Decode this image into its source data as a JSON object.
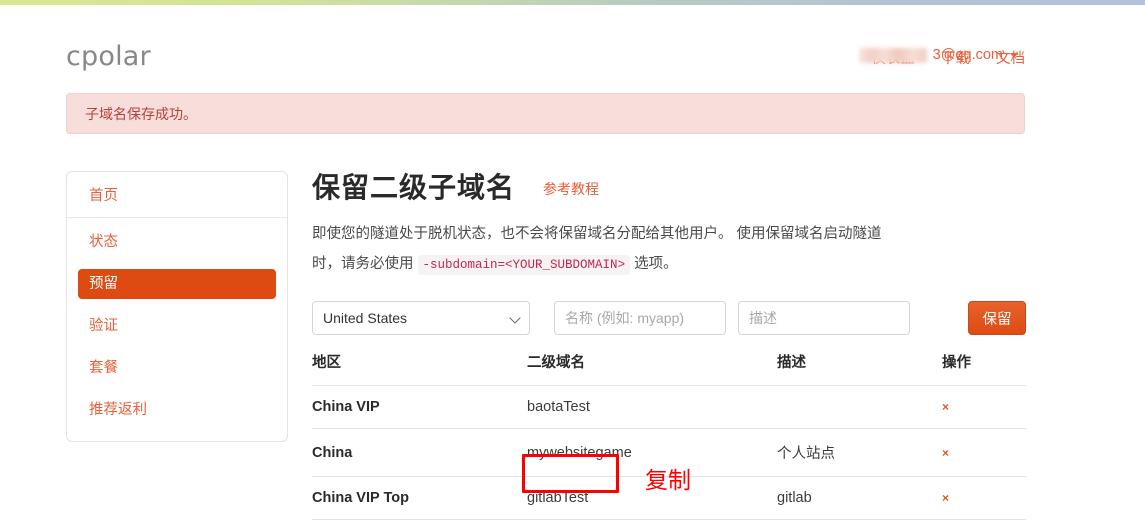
{
  "brand": "cpolar",
  "topbar": {
    "nav_links": [
      {
        "label": "仪表盘"
      },
      {
        "label": "下载"
      },
      {
        "label": "文档"
      }
    ],
    "account": {
      "email_suffix": "3@qq.com",
      "caret_icon": "chevron-down-icon"
    }
  },
  "alert": {
    "message": "子域名保存成功。",
    "bg_color": "#f8dedb",
    "text_color": "#b7403c"
  },
  "sidebar": {
    "header_label": "首页",
    "items": [
      {
        "label": "状态",
        "active": false
      },
      {
        "label": "预留",
        "active": true
      },
      {
        "label": "验证",
        "active": false
      },
      {
        "label": "套餐",
        "active": false
      },
      {
        "label": "推荐返利",
        "active": false
      }
    ],
    "active_bg": "#dd4b12",
    "link_color": "#e8603c"
  },
  "main": {
    "title": "保留二级子域名",
    "tutorial_link": "参考教程",
    "description_part1": "即使您的隧道处于脱机状态，也不会将保留域名分配给其他用户。 使用保留域名启动隧道时，请务必使用",
    "description_code": "-subdomain=<YOUR_SUBDOMAIN>",
    "description_part2": "选项。",
    "form": {
      "region_selected": "United States",
      "region_options": [
        "United States"
      ],
      "name_placeholder": "名称 (例如: myapp)",
      "name_value": "",
      "desc_placeholder": "描述",
      "desc_value": "",
      "submit_label": "保留",
      "submit_color": "#dd4b12"
    },
    "table": {
      "headers": [
        "地区",
        "二级域名",
        "描述",
        "操作"
      ],
      "rows": [
        {
          "region": "China VIP",
          "domain": "baotaTest",
          "desc": "",
          "action": "×"
        },
        {
          "region": "China",
          "domain": "mywebsitegame",
          "desc": "个人站点",
          "action": "×"
        },
        {
          "region": "China VIP Top",
          "domain": "gitlabTest",
          "desc": "gitlab",
          "action": "×"
        }
      ]
    }
  },
  "annotations": {
    "highlight_target": "gitlabTest",
    "label": "复制",
    "color": "#ff0000"
  }
}
